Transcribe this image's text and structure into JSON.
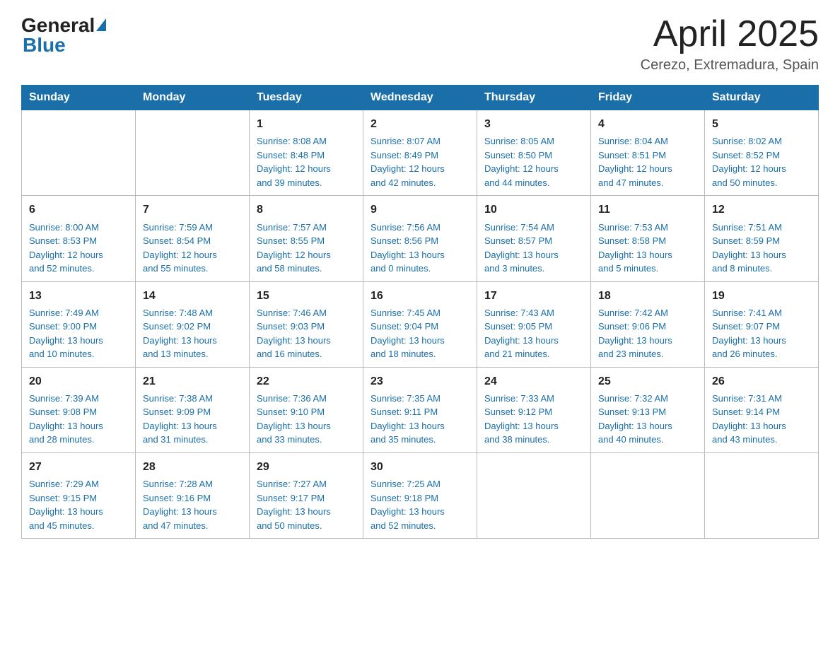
{
  "header": {
    "logo_general": "General",
    "logo_blue": "Blue",
    "title": "April 2025",
    "subtitle": "Cerezo, Extremadura, Spain"
  },
  "days_of_week": [
    "Sunday",
    "Monday",
    "Tuesday",
    "Wednesday",
    "Thursday",
    "Friday",
    "Saturday"
  ],
  "weeks": [
    [
      {
        "day": "",
        "info": ""
      },
      {
        "day": "",
        "info": ""
      },
      {
        "day": "1",
        "info": "Sunrise: 8:08 AM\nSunset: 8:48 PM\nDaylight: 12 hours\nand 39 minutes."
      },
      {
        "day": "2",
        "info": "Sunrise: 8:07 AM\nSunset: 8:49 PM\nDaylight: 12 hours\nand 42 minutes."
      },
      {
        "day": "3",
        "info": "Sunrise: 8:05 AM\nSunset: 8:50 PM\nDaylight: 12 hours\nand 44 minutes."
      },
      {
        "day": "4",
        "info": "Sunrise: 8:04 AM\nSunset: 8:51 PM\nDaylight: 12 hours\nand 47 minutes."
      },
      {
        "day": "5",
        "info": "Sunrise: 8:02 AM\nSunset: 8:52 PM\nDaylight: 12 hours\nand 50 minutes."
      }
    ],
    [
      {
        "day": "6",
        "info": "Sunrise: 8:00 AM\nSunset: 8:53 PM\nDaylight: 12 hours\nand 52 minutes."
      },
      {
        "day": "7",
        "info": "Sunrise: 7:59 AM\nSunset: 8:54 PM\nDaylight: 12 hours\nand 55 minutes."
      },
      {
        "day": "8",
        "info": "Sunrise: 7:57 AM\nSunset: 8:55 PM\nDaylight: 12 hours\nand 58 minutes."
      },
      {
        "day": "9",
        "info": "Sunrise: 7:56 AM\nSunset: 8:56 PM\nDaylight: 13 hours\nand 0 minutes."
      },
      {
        "day": "10",
        "info": "Sunrise: 7:54 AM\nSunset: 8:57 PM\nDaylight: 13 hours\nand 3 minutes."
      },
      {
        "day": "11",
        "info": "Sunrise: 7:53 AM\nSunset: 8:58 PM\nDaylight: 13 hours\nand 5 minutes."
      },
      {
        "day": "12",
        "info": "Sunrise: 7:51 AM\nSunset: 8:59 PM\nDaylight: 13 hours\nand 8 minutes."
      }
    ],
    [
      {
        "day": "13",
        "info": "Sunrise: 7:49 AM\nSunset: 9:00 PM\nDaylight: 13 hours\nand 10 minutes."
      },
      {
        "day": "14",
        "info": "Sunrise: 7:48 AM\nSunset: 9:02 PM\nDaylight: 13 hours\nand 13 minutes."
      },
      {
        "day": "15",
        "info": "Sunrise: 7:46 AM\nSunset: 9:03 PM\nDaylight: 13 hours\nand 16 minutes."
      },
      {
        "day": "16",
        "info": "Sunrise: 7:45 AM\nSunset: 9:04 PM\nDaylight: 13 hours\nand 18 minutes."
      },
      {
        "day": "17",
        "info": "Sunrise: 7:43 AM\nSunset: 9:05 PM\nDaylight: 13 hours\nand 21 minutes."
      },
      {
        "day": "18",
        "info": "Sunrise: 7:42 AM\nSunset: 9:06 PM\nDaylight: 13 hours\nand 23 minutes."
      },
      {
        "day": "19",
        "info": "Sunrise: 7:41 AM\nSunset: 9:07 PM\nDaylight: 13 hours\nand 26 minutes."
      }
    ],
    [
      {
        "day": "20",
        "info": "Sunrise: 7:39 AM\nSunset: 9:08 PM\nDaylight: 13 hours\nand 28 minutes."
      },
      {
        "day": "21",
        "info": "Sunrise: 7:38 AM\nSunset: 9:09 PM\nDaylight: 13 hours\nand 31 minutes."
      },
      {
        "day": "22",
        "info": "Sunrise: 7:36 AM\nSunset: 9:10 PM\nDaylight: 13 hours\nand 33 minutes."
      },
      {
        "day": "23",
        "info": "Sunrise: 7:35 AM\nSunset: 9:11 PM\nDaylight: 13 hours\nand 35 minutes."
      },
      {
        "day": "24",
        "info": "Sunrise: 7:33 AM\nSunset: 9:12 PM\nDaylight: 13 hours\nand 38 minutes."
      },
      {
        "day": "25",
        "info": "Sunrise: 7:32 AM\nSunset: 9:13 PM\nDaylight: 13 hours\nand 40 minutes."
      },
      {
        "day": "26",
        "info": "Sunrise: 7:31 AM\nSunset: 9:14 PM\nDaylight: 13 hours\nand 43 minutes."
      }
    ],
    [
      {
        "day": "27",
        "info": "Sunrise: 7:29 AM\nSunset: 9:15 PM\nDaylight: 13 hours\nand 45 minutes."
      },
      {
        "day": "28",
        "info": "Sunrise: 7:28 AM\nSunset: 9:16 PM\nDaylight: 13 hours\nand 47 minutes."
      },
      {
        "day": "29",
        "info": "Sunrise: 7:27 AM\nSunset: 9:17 PM\nDaylight: 13 hours\nand 50 minutes."
      },
      {
        "day": "30",
        "info": "Sunrise: 7:25 AM\nSunset: 9:18 PM\nDaylight: 13 hours\nand 52 minutes."
      },
      {
        "day": "",
        "info": ""
      },
      {
        "day": "",
        "info": ""
      },
      {
        "day": "",
        "info": ""
      }
    ]
  ]
}
